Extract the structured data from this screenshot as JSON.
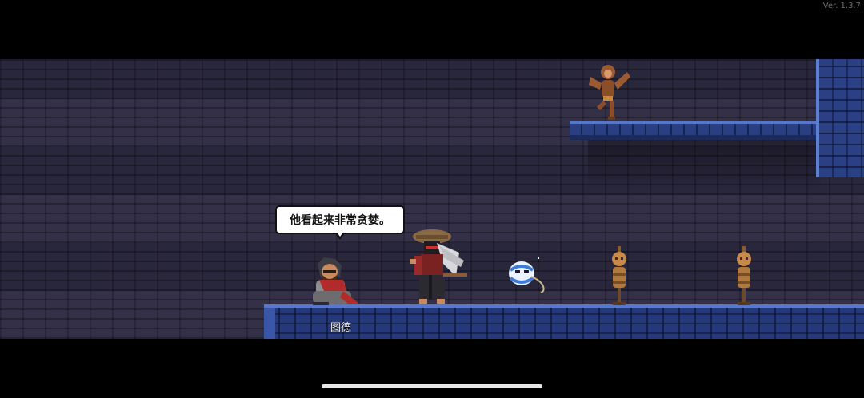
{
  "version_label": "Ver. 1.3.7",
  "dialogue": {
    "speech_text": "他看起来非常贪婪。",
    "npc_name": "图德"
  },
  "icons": {
    "hero": "samurai-player-icon",
    "npc": "crouching-bandit-npc-icon",
    "ghost": "blue-ghost-icon",
    "monkey": "monkey-dummy-icon",
    "dummies": [
      "scarecrow-dummy-icon",
      "scarecrow-dummy-icon"
    ]
  },
  "colors": {
    "wall": "#2f2c44",
    "stone_blue": "#2a3f82",
    "stone_highlight": "#5677c8"
  }
}
